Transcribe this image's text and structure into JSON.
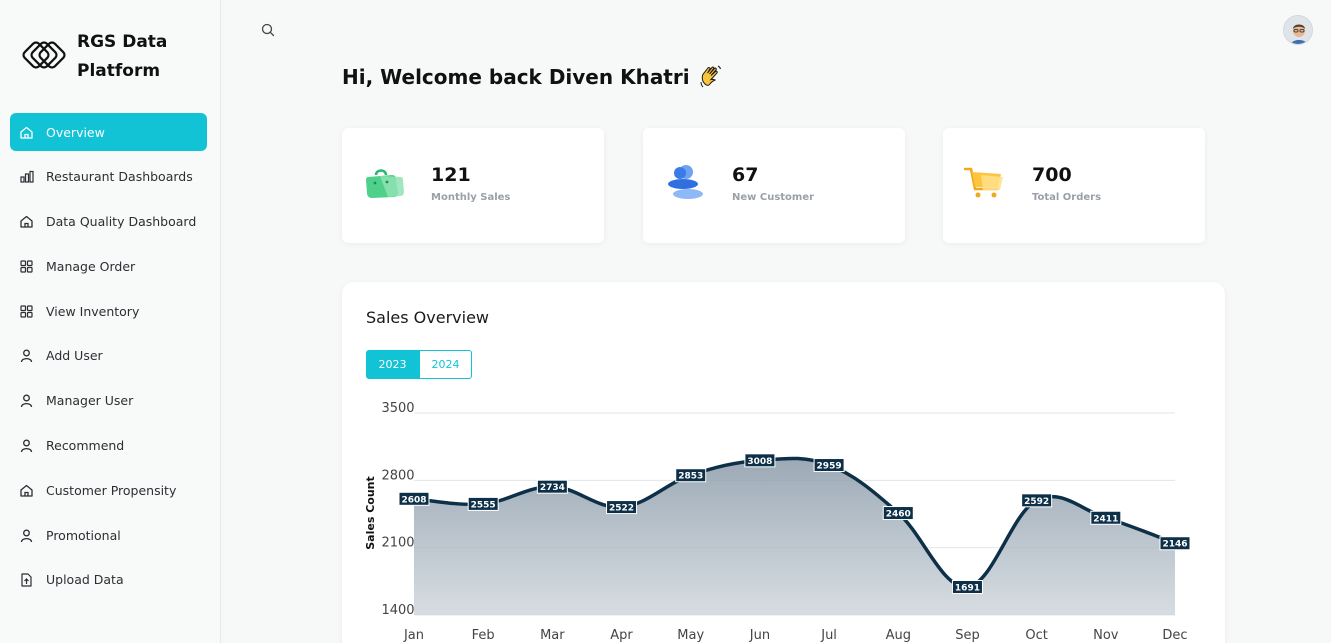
{
  "brand": {
    "name": "RGS Data Platform"
  },
  "sidebar": {
    "items": [
      {
        "label": "Overview",
        "icon": "home-icon",
        "active": true
      },
      {
        "label": "Restaurant Dashboards",
        "icon": "bar-chart-icon"
      },
      {
        "label": "Data Quality Dashboard",
        "icon": "home-icon"
      },
      {
        "label": "Manage Order",
        "icon": "grid-icon"
      },
      {
        "label": "View Inventory",
        "icon": "grid-icon"
      },
      {
        "label": "Add User",
        "icon": "user-icon"
      },
      {
        "label": "Manager User",
        "icon": "user-icon"
      },
      {
        "label": "Recommend",
        "icon": "user-icon"
      },
      {
        "label": "Customer Propensity",
        "icon": "home-icon"
      },
      {
        "label": "Promotional",
        "icon": "user-icon"
      },
      {
        "label": "Upload Data",
        "icon": "upload-icon"
      }
    ]
  },
  "header": {
    "greeting": "Hi, Welcome back Diven Khatri"
  },
  "stats": [
    {
      "value": "121",
      "label": "Monthly Sales",
      "icon": "shopping-bag-icon"
    },
    {
      "value": "67",
      "label": "New Customer",
      "icon": "users-icon"
    },
    {
      "value": "700",
      "label": "Total Orders",
      "icon": "cart-icon"
    }
  ],
  "sales": {
    "title": "Sales Overview",
    "years": [
      "2023",
      "2024"
    ],
    "selected_year": "2023"
  },
  "colors": {
    "accent": "#12c3d6",
    "line": "#0d3048"
  },
  "chart_data": {
    "type": "area",
    "categories": [
      "Jan",
      "Feb",
      "Mar",
      "Apr",
      "May",
      "Jun",
      "Jul",
      "Aug",
      "Sep",
      "Oct",
      "Nov",
      "Dec"
    ],
    "values": [
      2608,
      2555,
      2734,
      2522,
      2853,
      3008,
      2959,
      2460,
      1691,
      2592,
      2411,
      2146
    ],
    "ylabel": "Sales Count",
    "yticks": [
      1400,
      2100,
      2800,
      3500
    ],
    "ylim": [
      1400,
      3500
    ],
    "grid": true,
    "data_labels": true
  }
}
